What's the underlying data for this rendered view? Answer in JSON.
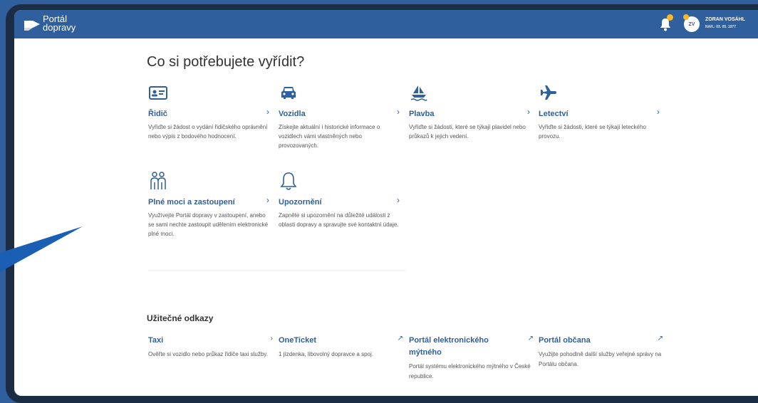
{
  "app": {
    "logo_line1": "Portál",
    "logo_line2": "dopravy"
  },
  "user": {
    "initials": "ZV",
    "name": "ZORAN VOSÁHL",
    "dob": "NAR.: 03. 05. 1977"
  },
  "main": {
    "heading": "Co si potřebujete vyřídit?",
    "cards": [
      {
        "title": "Řidič",
        "icon": "id-card-icon",
        "desc": "Vyřiďte si žádost o vydání řidičského oprávnění nebo výpis z bodového hodnocení."
      },
      {
        "title": "Vozidla",
        "icon": "car-icon",
        "desc": "Získejte aktuální i historické informace o vozidlech vámi vlastněných nebo provozovaných."
      },
      {
        "title": "Plavba",
        "icon": "boat-icon",
        "desc": "Vyřiďte si žádosti, které se týkají plavidel nebo průkazů k jejich vedení."
      },
      {
        "title": "Letectví",
        "icon": "airplane-icon",
        "desc": "Vyřiďte si žádosti, které se týkají leteckého provozu."
      },
      {
        "title": "Plné moci a zastoupení",
        "icon": "people-icon",
        "desc": "Využívejte Portál dopravy v zastoupení, anebo se sami nechte zastoupit udělením elektronické plné moci."
      },
      {
        "title": "Upozornění",
        "icon": "bell-outline-icon",
        "desc": "Zapněte si upozornění na důležité události z oblasti dopravy a spravujte své kontaktní údaje."
      }
    ]
  },
  "links": {
    "heading": "Užitečné odkazy",
    "items": [
      {
        "title": "Taxi",
        "desc": "Ověřte si vozidlo nebo průkaz řidiče taxi služby.",
        "external": false
      },
      {
        "title": "OneTicket",
        "desc": "1 jízdenka, libovolný dopravce a spoj.",
        "external": true
      },
      {
        "title": "Portál elektronického mýtného",
        "desc": "Portál systému elektronického mýtného v České republice.",
        "external": true
      },
      {
        "title": "Portál občana",
        "desc": "Využijte pohodlně další služby veřejné správy na Portálu občana.",
        "external": true
      }
    ]
  },
  "colors": {
    "brand": "#2f5f9c",
    "accent_dot": "#f6b72c",
    "arrow": "#1a5fb4"
  }
}
